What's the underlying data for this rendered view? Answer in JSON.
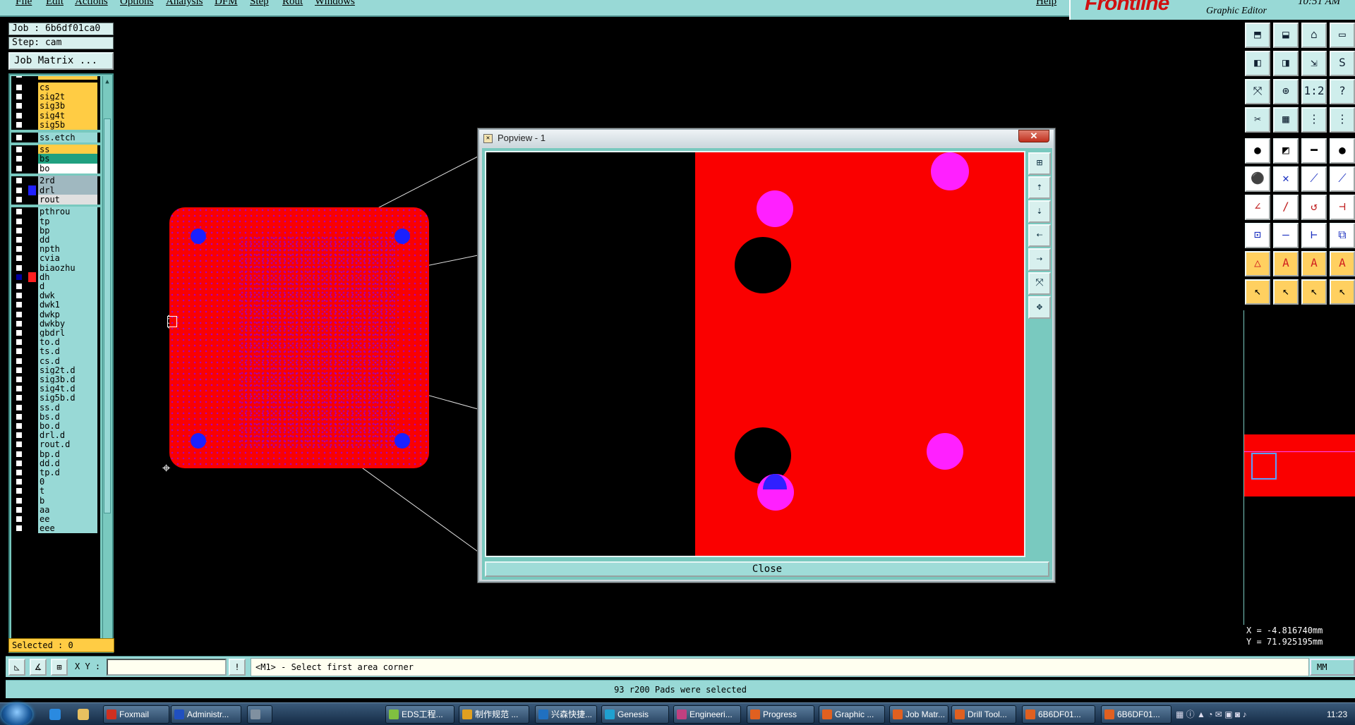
{
  "menu": {
    "items": [
      "File",
      "Edit",
      "Actions",
      "Options",
      "Analysis",
      "DFM",
      "Step",
      "Rout",
      "Windows"
    ],
    "help": "Help"
  },
  "brand": {
    "logo": "Frontline",
    "subtitle": "Graphic Editor",
    "time": "10:51 AM"
  },
  "job": {
    "job_label": "Job : 6b6df01ca0",
    "step_label": "Step: cam",
    "matrix_button": "Job Matrix ..."
  },
  "layers": [
    {
      "name": "cs",
      "color": "#ffcc44"
    },
    {
      "name": "sig2t",
      "color": "#ffcc44"
    },
    {
      "name": "sig3b",
      "color": "#ffcc44"
    },
    {
      "name": "sig4t",
      "color": "#ffcc44"
    },
    {
      "name": "sig5b",
      "color": "#ffcc44"
    },
    {
      "name": "ss.etch",
      "color": "#98d9d6"
    },
    {
      "name": "ss",
      "color": "#ffcc44"
    },
    {
      "name": "bs",
      "color": "#20a080"
    },
    {
      "name": "bo",
      "color": "#ffffff",
      "mark": "✎"
    },
    {
      "name": "2rd",
      "color": "#a0b8c0"
    },
    {
      "name": "drl",
      "color": "#a0b8c0"
    },
    {
      "name": "rout",
      "color": "#e0e0e0"
    },
    {
      "name": "pthrou",
      "color": "#98d9d6"
    },
    {
      "name": "tp",
      "color": "#98d9d6"
    },
    {
      "name": "bp",
      "color": "#98d9d6"
    },
    {
      "name": "dd",
      "color": "#98d9d6"
    },
    {
      "name": "npth",
      "color": "#98d9d6"
    },
    {
      "name": "cvia",
      "color": "#98d9d6"
    },
    {
      "name": "biaozhu",
      "color": "#98d9d6"
    },
    {
      "name": "dh",
      "color": "#98d9d6",
      "mark": "■"
    },
    {
      "name": "d",
      "color": "#98d9d6"
    },
    {
      "name": "dwk",
      "color": "#98d9d6"
    },
    {
      "name": "dwk1",
      "color": "#98d9d6"
    },
    {
      "name": "dwkp",
      "color": "#98d9d6"
    },
    {
      "name": "dwkby",
      "color": "#98d9d6"
    },
    {
      "name": "gbdrl",
      "color": "#98d9d6"
    },
    {
      "name": "to.d",
      "color": "#98d9d6",
      "mark": "✎"
    },
    {
      "name": "ts.d",
      "color": "#98d9d6"
    },
    {
      "name": "cs.d",
      "color": "#98d9d6"
    },
    {
      "name": "sig2t.d",
      "color": "#98d9d6"
    },
    {
      "name": "sig3b.d",
      "color": "#98d9d6"
    },
    {
      "name": "sig4t.d",
      "color": "#98d9d6"
    },
    {
      "name": "sig5b.d",
      "color": "#98d9d6"
    },
    {
      "name": "ss.d",
      "color": "#98d9d6"
    },
    {
      "name": "bs.d",
      "color": "#98d9d6"
    },
    {
      "name": "bo.d",
      "color": "#98d9d6",
      "mark": "✎"
    },
    {
      "name": "drl.d",
      "color": "#98d9d6"
    },
    {
      "name": "rout.d",
      "color": "#98d9d6"
    },
    {
      "name": "bp.d",
      "color": "#98d9d6"
    },
    {
      "name": "dd.d",
      "color": "#98d9d6"
    },
    {
      "name": "tp.d",
      "color": "#98d9d6"
    },
    {
      "name": "0",
      "color": "#98d9d6"
    },
    {
      "name": "t",
      "color": "#98d9d6"
    },
    {
      "name": "b",
      "color": "#98d9d6"
    },
    {
      "name": "aa",
      "color": "#98d9d6"
    },
    {
      "name": "ee",
      "color": "#98d9d6"
    },
    {
      "name": "eee",
      "color": "#98d9d6"
    }
  ],
  "selected": "Selected : 0",
  "popview": {
    "title": "Popview - 1",
    "close_label": "Close",
    "close_x": "✕"
  },
  "coords": {
    "x": "X = -4.816740mm",
    "y": "Y = 71.925195mm"
  },
  "command": {
    "xy_label": "X Y :",
    "xy_value": "",
    "prompt": "<M1> - Select first area corner",
    "unit": "MM"
  },
  "status": "93 r200 Pads were selected",
  "taskbar": {
    "tasks": [
      "Foxmail",
      "Administr...",
      "",
      "EDS工程...",
      "制作规范 ...",
      "兴森快捷...",
      "Genesis",
      "Engineeri...",
      "Progress",
      "Graphic ...",
      "Job Matr...",
      "Drill Tool...",
      "6B6DF01...",
      "6B6DF01..."
    ],
    "clock": "11:23"
  }
}
